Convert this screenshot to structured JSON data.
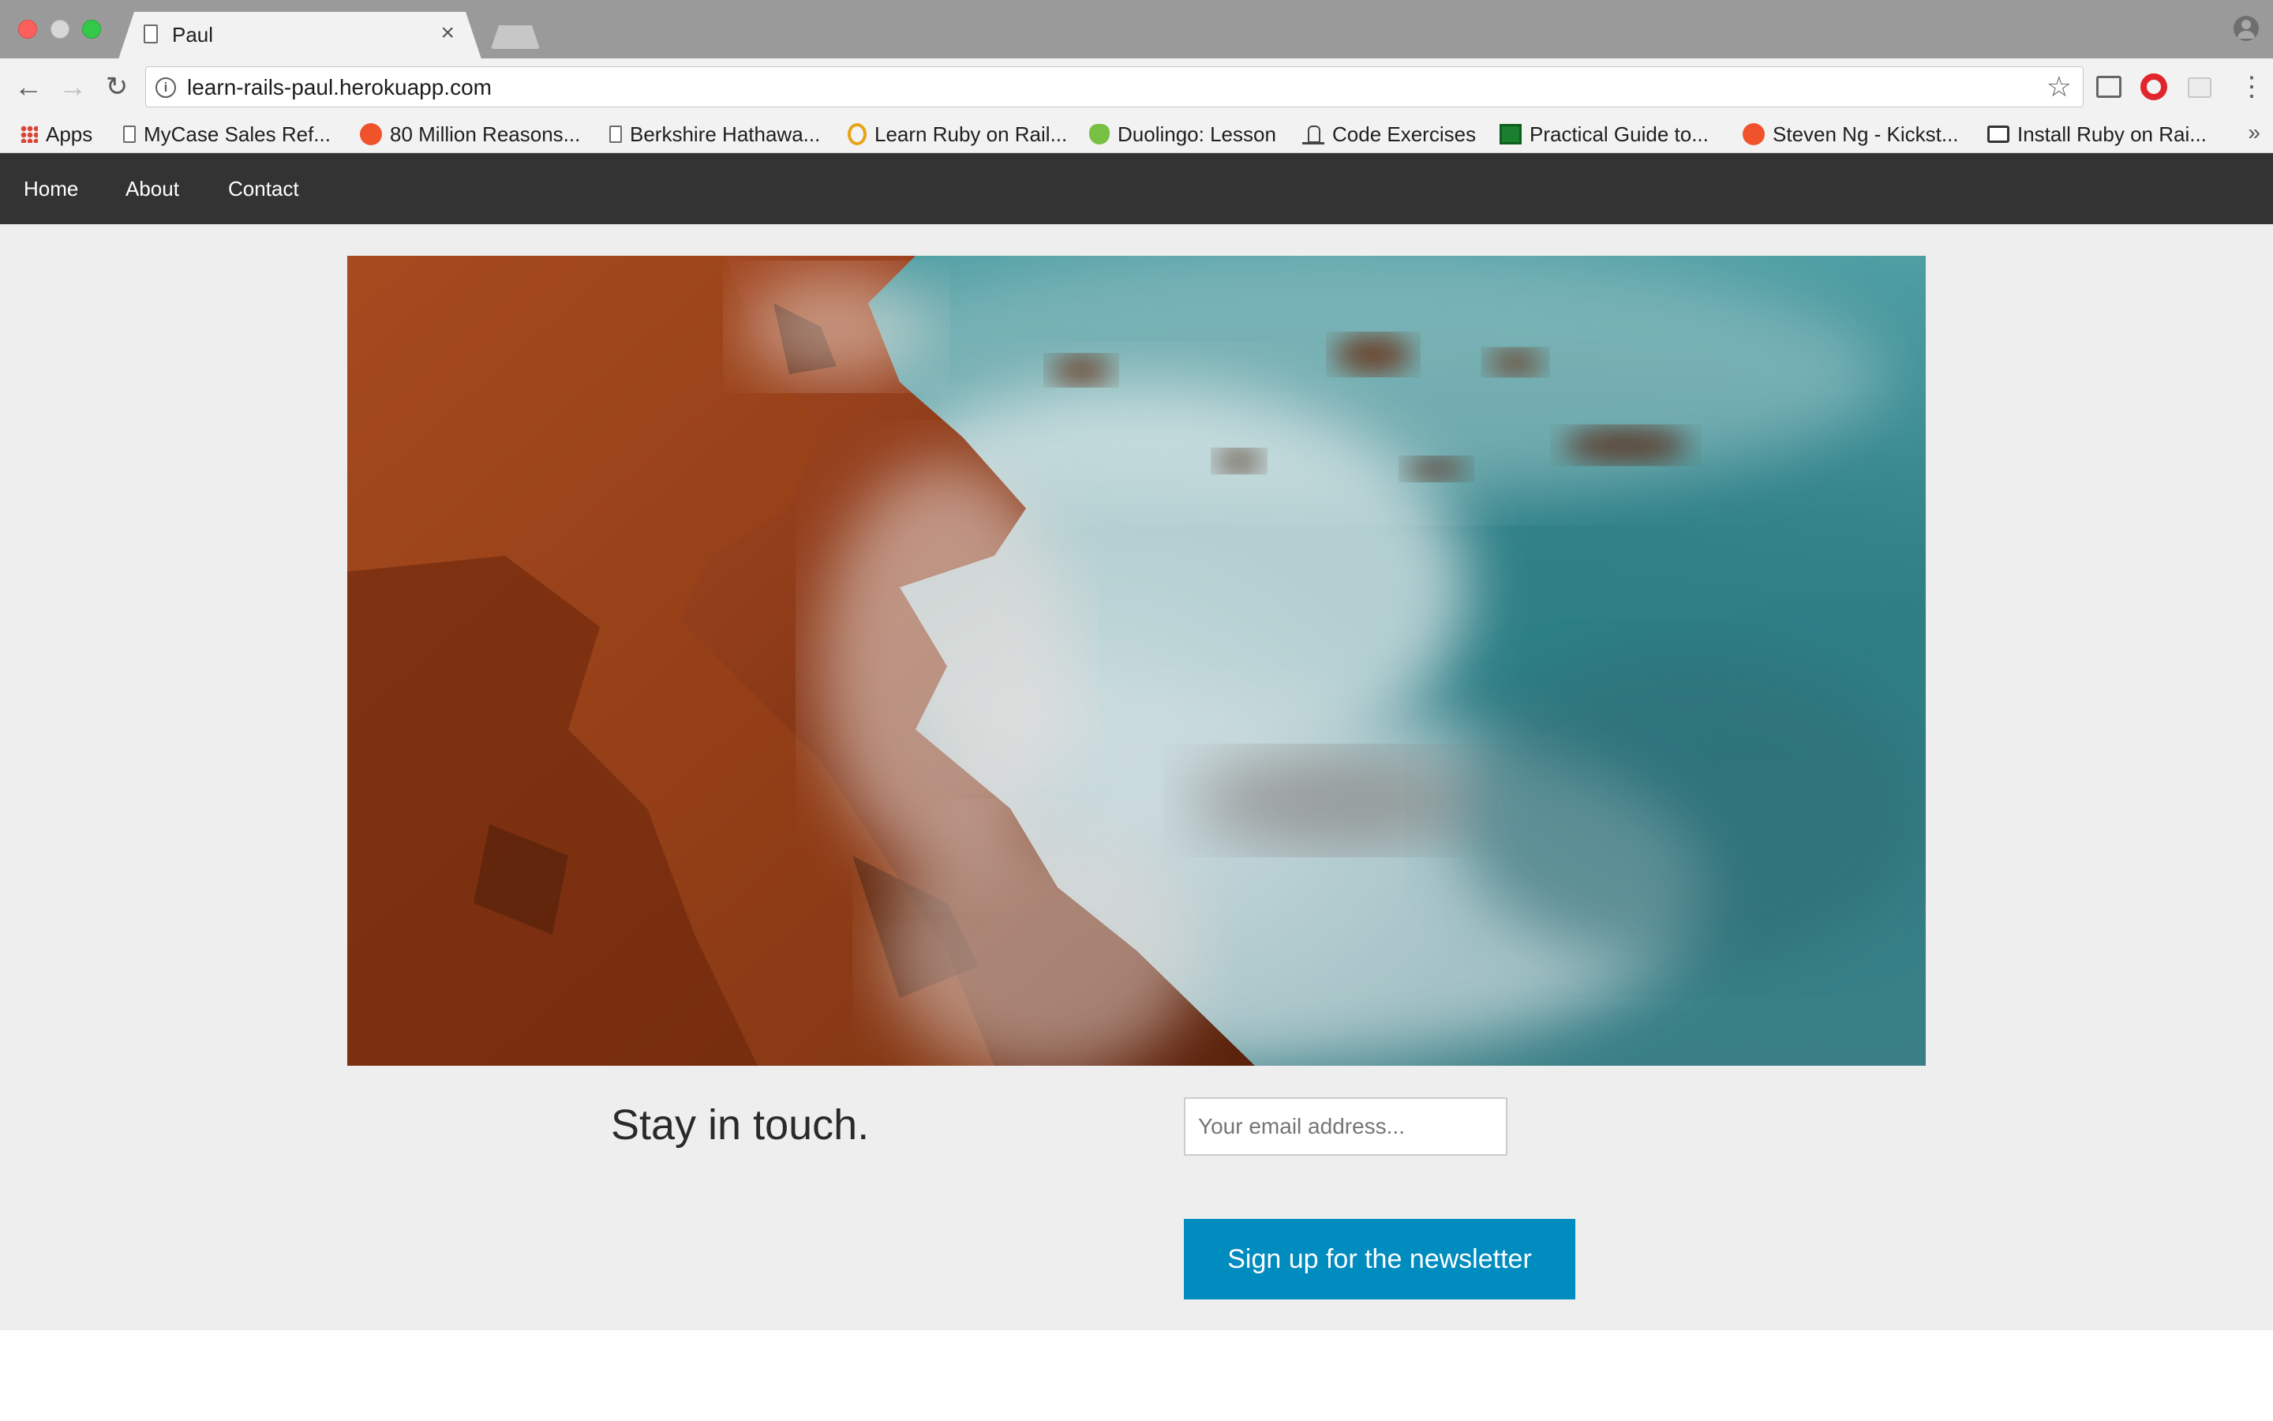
{
  "browser": {
    "tab": {
      "title": "Paul",
      "close_glyph": "×"
    },
    "address_bar": {
      "url": "learn-rails-paul.herokuapp.com",
      "info_glyph": "i"
    },
    "bookmarks": [
      {
        "label": "Apps",
        "icon": "apps-grid-icon"
      },
      {
        "label": "MyCase Sales Ref...",
        "icon": "page-icon"
      },
      {
        "label": "80 Million Reasons...",
        "icon": "red-circle-icon"
      },
      {
        "label": "Berkshire Hathawa...",
        "icon": "page-icon"
      },
      {
        "label": "Learn Ruby on Rail...",
        "icon": "odin-icon"
      },
      {
        "label": "Duolingo: Lesson",
        "icon": "owl-icon"
      },
      {
        "label": "Code Exercises",
        "icon": "code-icon"
      },
      {
        "label": "Practical Guide to...",
        "icon": "green-icon"
      },
      {
        "label": "Steven Ng - Kickst...",
        "icon": "red-circle-icon"
      },
      {
        "label": "Install Ruby on Rai...",
        "icon": "install-icon"
      }
    ],
    "bookmarks_more": "»"
  },
  "site": {
    "nav": {
      "home": "Home",
      "about": "About",
      "contact": "Contact"
    },
    "hero": {
      "description": "rocky coastline at sunset with misty turquoise sea"
    },
    "cta": {
      "title": "Stay in touch.",
      "email_placeholder": "Your email address...",
      "email_value": "",
      "button": "Sign up for the newsletter"
    }
  },
  "colors": {
    "navbar": "#333333",
    "page_bg": "#eeeeee",
    "button": "#008cbf"
  }
}
